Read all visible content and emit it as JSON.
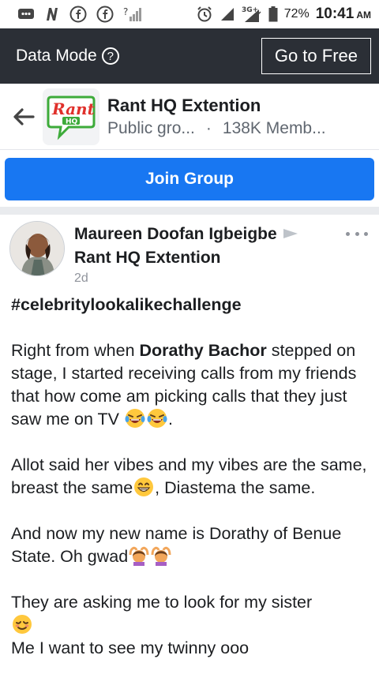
{
  "status_bar": {
    "battery": "72%",
    "time": "10:41",
    "ampm": "AM",
    "network": "3G+"
  },
  "data_mode": {
    "label": "Data Mode",
    "info_glyph": "?",
    "go_free": "Go to Free"
  },
  "group": {
    "name": "Rant HQ Extention",
    "privacy": "Public gro...",
    "separator": "·",
    "members": "138K Memb...",
    "logo_text": "Rant",
    "logo_sub": "HQ"
  },
  "join_label": "Join Group",
  "post": {
    "author": "Maureen Doofan Igbeigbe",
    "group": "Rant HQ Extention",
    "time": "2d",
    "hashtag": "#celebritylookalikechallenge",
    "p1_a": "Right from when ",
    "p1_bold": "Dorathy Bachor",
    "p1_b": " stepped on stage, I started receiving calls from my friends that how come am picking calls that they just saw me on TV ",
    "p1_end": ".",
    "p2_a": "Allot said her vibes and my vibes are the same, breast the same",
    "p2_b": ", Diastema the same.",
    "p3": "And now my new name is Dorathy of Benue State. Oh gwad",
    "p4": "They are asking me to look for my sister",
    "p5": "Me I want to see my twinny ooo"
  },
  "colors": {
    "data_mode_bg": "#2b2f36",
    "join_button": "#1877f2",
    "logo_green": "#3dab3a",
    "logo_red": "#e0302b"
  }
}
